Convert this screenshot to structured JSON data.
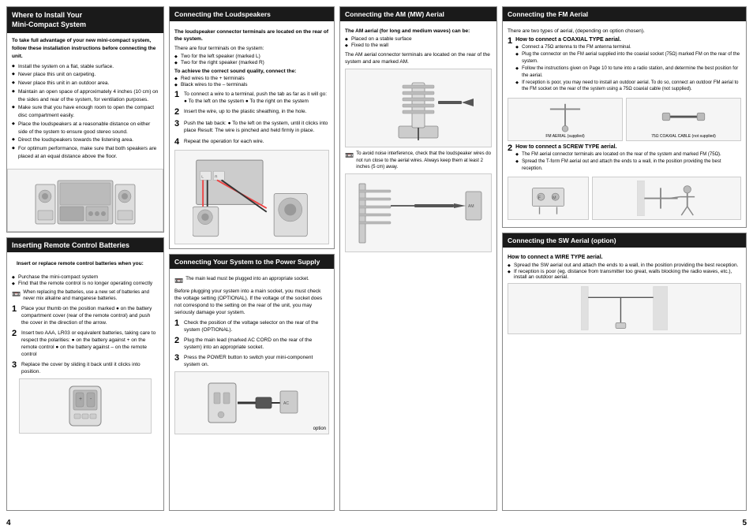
{
  "page": {
    "numbers": {
      "left": "4",
      "right": "5"
    }
  },
  "install_section": {
    "header": "Where to Install Your\nMini-Compact System",
    "intro": "To take full advantage of your new mini-compact system, follow\nthese installation instructions before connecting the unit.",
    "items": [
      "Install the system on a flat, stable surface.",
      "Never place this unit on carpeting.",
      "Never place this unit in an outdoor area.",
      "Maintain an open space of approximately 4 inches (10 cm) on the sides and rear of the system, for ventilation purposes.",
      "Make sure that you have enough room to open the compact disc compartment easily.",
      "Place the loudspeakers at a reasonable distance on either side of the system to ensure good stereo sound.",
      "Direct the loudspeakers towards the listening area.",
      "For optimum performance, make sure that both speakers are placed at an equal distance above the floor."
    ]
  },
  "remote_section": {
    "header": "Inserting Remote Control Batteries",
    "intro": "Insert or replace remote control batteries when you:",
    "bullets": [
      "Purchase the mini-compact system",
      "Find that the remote control is no longer operating correctly"
    ],
    "note": "When replacing the batteries, use a new set of batteries and never mix alkaline and manganese batteries.",
    "steps": [
      {
        "num": "1",
        "text": "Place your thumb on the position marked ● on the battery compartment cover (rear of the remote control) and push the cover in the direction of the arrow."
      },
      {
        "num": "2",
        "text": "Insert two AAA, LR03 or equivalent batteries, taking care to respect the polarities: ● on the battery against + on the remote control ● on the battery against – on the remote control"
      },
      {
        "num": "3",
        "text": "Replace the cover by sliding it back until it clicks into position."
      }
    ]
  },
  "loudspeaker_section": {
    "header": "Connecting the Loudspeakers",
    "note": "The loudspeaker connector terminals are located on the rear of the system.",
    "terminals_info": "There are four terminals on the system:",
    "terminals": [
      "Two for the left speaker (marked L)",
      "Two for the right speaker (marked R)"
    ],
    "achieve_title": "To achieve the correct sound quality, connect the:",
    "achieve_items": [
      "Red wires to the + terminals",
      "Black wires to the – terminals"
    ],
    "steps": [
      {
        "num": "1",
        "text": "To connect a wire to a terminal, push the tab as far as it will go: ● To the left on the system ● To the right on the system"
      },
      {
        "num": "2",
        "text": "Insert the wire, up to the plastic sheathing, in the hole."
      },
      {
        "num": "3",
        "text": "Push the tab back: ● To the left on the system, until it clicks into place Result: The wire is pinched and held firmly in place."
      },
      {
        "num": "4",
        "text": "Repeat the operation for each wire."
      }
    ]
  },
  "power_section": {
    "header": "Connecting Your System to the Power Supply",
    "note": "The main lead must be plugged into an appropriate socket.",
    "intro": "Before plugging your system into a main socket, you must check the voltage setting (OPTIONAL). If the voltage of the socket does not correspond to the setting on the rear of the unit, you may seriously damage your system.",
    "steps": [
      {
        "num": "1",
        "text": "Check the position of the voltage selector on the rear of the system (OPTIONAL)."
      },
      {
        "num": "2",
        "text": "Plug the main lead (marked AC CORD on the rear of the system) into an appropriate socket."
      },
      {
        "num": "3",
        "text": "Press the POWER button to switch your mini-component system on."
      }
    ],
    "image_label": "option"
  },
  "am_section": {
    "header": "Connecting the AM (MW) Aerial",
    "intro": "The AM aerial (for long and medium waves) can be:",
    "placement": [
      "Placed on a stable surface",
      "Fixed to the wall"
    ],
    "connector_note": "The AM aerial connector terminals are located on the rear of the system and are marked AM.",
    "interference_note": "To avoid noise interference, check that the loudspeaker wires do not run close to the aerial wires. Always keep them at least 2 inches (5 cm) away."
  },
  "fm_section": {
    "header": "Connecting the FM Aerial",
    "intro": "There are two types of aerial, (depending on option chosen).",
    "step1": {
      "num": "1",
      "title": "How to connect a COAXIAL TYPE aerial.",
      "bullets": [
        "Connect a 75Ω antenna to the FM antenna terminal.",
        "Plug the connector on the FM aerial supplied into the coaxial socket (75Ω) marked FM on the rear of the system.",
        "Follow the instructions given on Page 10 to tune into a radio station, and determine the best position for the aerial.",
        "If reception is poor, you may need to install an outdoor aerial. To do so, connect an outdoor FM aerial to the FM socket on the rear of the system using a 75Ω coaxial cable (not supplied)."
      ]
    },
    "step2": {
      "num": "2",
      "title": "How to connect a SCREW TYPE aerial.",
      "bullets": [
        "The FM aerial connector terminals are located on the rear of the system and marked FM (75Ω).",
        "Spread the T-form FM aerial out and attach the ends to a wall, in the position providing the best reception."
      ]
    },
    "image1_label": "FM AERIAL (supplied)",
    "image2_label": "75Ω COAXIAL CABLE (not supplied)"
  },
  "sw_section": {
    "header": "Connecting the SW Aerial (option)",
    "step1_title": "How to connect a WIRE TYPE aerial.",
    "bullets": [
      "Spread the SW aerial out and attach the ends to a wall, in the position providing the best reception.",
      "If reception is poor (eg. distance from transmitter too great, walls blocking the radio waves, etc.), install an outdoor aerial."
    ]
  }
}
